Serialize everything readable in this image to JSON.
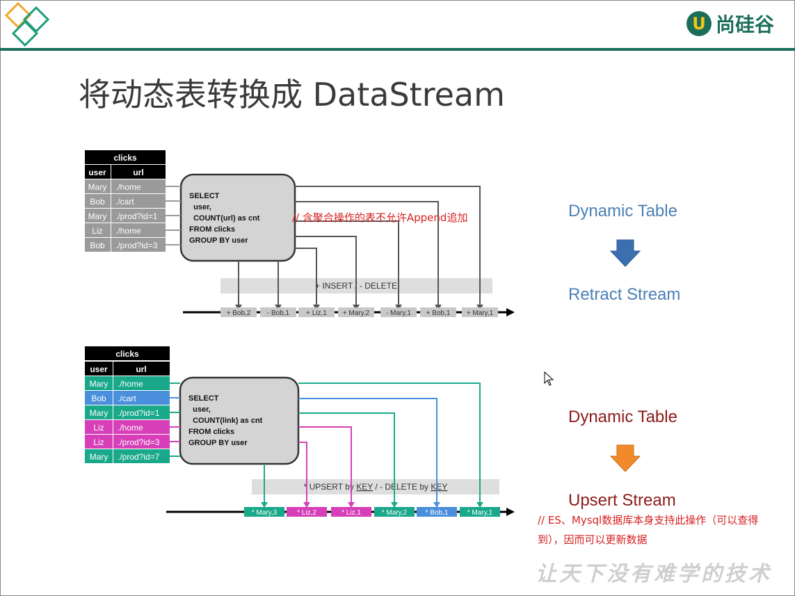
{
  "brand": {
    "logo_letter": "U",
    "name": "尚硅谷"
  },
  "title": "将动态表转换成 DataStream",
  "diagram1": {
    "table_title": "clicks",
    "headers": [
      "user",
      "url"
    ],
    "rows": [
      {
        "user": "Mary",
        "url": "./home"
      },
      {
        "user": "Bob",
        "url": "./cart"
      },
      {
        "user": "Mary",
        "url": "./prod?id=1"
      },
      {
        "user": "Liz",
        "url": "./home"
      },
      {
        "user": "Bob",
        "url": "./prod?id=3"
      }
    ],
    "sql": [
      "SELECT",
      "  user,",
      "  COUNT(url) as cnt",
      "FROM clicks",
      "GROUP BY user"
    ],
    "op_bar": "+ INSERT / - DELETE",
    "events": [
      "+ Bob,2",
      "- Bob,1",
      "+ Liz,1",
      "+ Mary,2",
      "- Mary,1",
      "+ Bob,1",
      "+ Mary,1"
    ]
  },
  "diagram2": {
    "table_title": "clicks",
    "headers": [
      "user",
      "url"
    ],
    "rows": [
      {
        "user": "Mary",
        "url": "./home"
      },
      {
        "user": "Bob",
        "url": "./cart"
      },
      {
        "user": "Mary",
        "url": "./prod?id=1"
      },
      {
        "user": "Liz",
        "url": "./home"
      },
      {
        "user": "Liz",
        "url": "./prod?id=3"
      },
      {
        "user": "Mary",
        "url": "./prod?id=7"
      }
    ],
    "sql": [
      "SELECT",
      "  user,",
      "  COUNT(link) as cnt",
      "FROM clicks",
      "GROUP BY user"
    ],
    "op_bar_prefix": "* UPSERT by ",
    "op_bar_key1": "KEY",
    "op_bar_mid": " / - DELETE by ",
    "op_bar_key2": "KEY",
    "events": [
      "* Mary,3",
      "* Liz,2",
      "* Liz,1",
      "* Mary,2",
      "* Bob,1",
      "* Mary,1"
    ]
  },
  "labels": {
    "dynamic_table_1": "Dynamic Table",
    "retract_stream": "Retract Stream",
    "dynamic_table_2": "Dynamic Table",
    "upsert_stream": "Upsert Stream"
  },
  "annotations": {
    "append_note": "// 含聚合操作的表不允许Append追加",
    "upsert_note_line1": "// ES、Mysql数据库本身支持此操作（可以查得",
    "upsert_note_line2": "到），因而可以更新数据"
  },
  "watermark": "让天下没有难学的技术",
  "colors": {
    "mary": "#19a88a",
    "bob": "#4a8fdc",
    "liz": "#d63fb8",
    "gray_row": "#9a9a9a",
    "blue_arrow": "#3b6fb0",
    "orange_arrow": "#f08a2a"
  }
}
